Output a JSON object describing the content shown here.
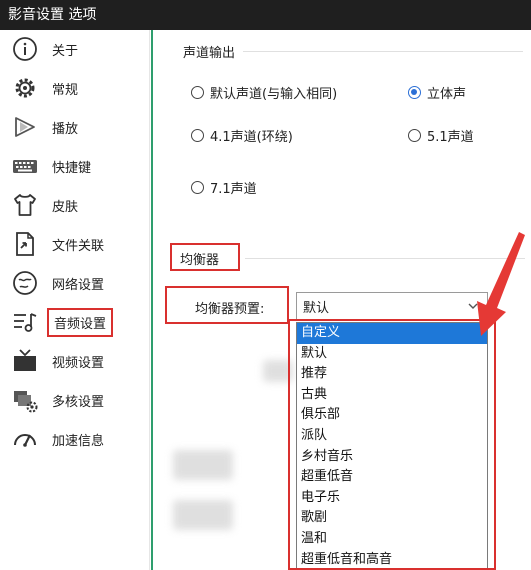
{
  "window": {
    "title": "影音设置 选项"
  },
  "sidebar": {
    "items": [
      {
        "label": "关于",
        "icon": "info-icon"
      },
      {
        "label": "常规",
        "icon": "gear-icon"
      },
      {
        "label": "播放",
        "icon": "play-icon"
      },
      {
        "label": "快捷键",
        "icon": "keyboard-icon"
      },
      {
        "label": "皮肤",
        "icon": "tshirt-icon"
      },
      {
        "label": "文件关联",
        "icon": "file-link-icon"
      },
      {
        "label": "网络设置",
        "icon": "network-icon"
      },
      {
        "label": "音频设置",
        "icon": "audio-icon",
        "active": true
      },
      {
        "label": "视频设置",
        "icon": "tv-icon"
      },
      {
        "label": "多核设置",
        "icon": "multicore-icon"
      },
      {
        "label": "加速信息",
        "icon": "speedometer-icon"
      }
    ]
  },
  "channel_output": {
    "label": "声道输出",
    "options": [
      {
        "label": "默认声道(与输入相同)",
        "checked": false
      },
      {
        "label": "立体声",
        "checked": true
      },
      {
        "label": "4.1声道(环绕)",
        "checked": false
      },
      {
        "label": "5.1声道",
        "checked": false
      },
      {
        "label": "7.1声道",
        "checked": false
      }
    ]
  },
  "equalizer": {
    "label": "均衡器",
    "preset_label": "均衡器预置:",
    "preset_value": "默认",
    "options": [
      "自定义",
      "默认",
      "推荐",
      "古典",
      "俱乐部",
      "派队",
      "乡村音乐",
      "超重低音",
      "电子乐",
      "歌剧",
      "温和",
      "超重低音和高音"
    ],
    "highlighted_index": 0
  },
  "colors": {
    "titlebar": "#1f1f1f",
    "accent_green": "#2e9e6d",
    "highlight_red": "#d9302e",
    "selection_blue": "#1e78d8"
  }
}
